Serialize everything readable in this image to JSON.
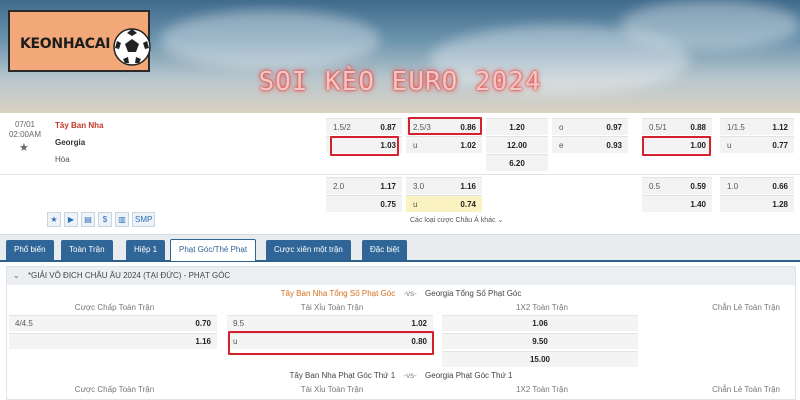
{
  "banner": {
    "logo_text": "KEONHACAI",
    "title": "SOI KÈO EURO 2024"
  },
  "match": {
    "date": "07/01",
    "time": "02:00AM",
    "home": "Tây Ban Nha",
    "away": "Georgia",
    "draw": "Hòa",
    "row1": {
      "hdp1": {
        "line": "1.5/2",
        "home": "0.87",
        "away": "1.03"
      },
      "ou1": {
        "line": "2.5/3",
        "over": "0.86",
        "under_label": "u",
        "under": "1.02"
      },
      "x12": [
        "1.20",
        "12.00",
        "6.20"
      ],
      "oe": {
        "o_label": "o",
        "o": "0.97",
        "e_label": "e",
        "e": "0.93"
      },
      "hdp2": {
        "line": "0.5/1",
        "home": "0.88",
        "away": "1.00"
      },
      "ou2": {
        "line": "1/1.5",
        "over": "1.12",
        "under_label": "u",
        "under": "0.77"
      }
    },
    "row2": {
      "hdp1": {
        "line": "2.0",
        "home": "1.17",
        "away": "0.75"
      },
      "ou1": {
        "line": "3.0",
        "over": "1.16",
        "under_label": "u",
        "under": "0.74"
      },
      "hdp2": {
        "line": "0.5",
        "home": "0.59",
        "away": "1.40"
      },
      "ou2": {
        "line": "1.0",
        "over": "0.66",
        "under": "1.28"
      }
    },
    "icons": [
      "★",
      "▶",
      "▤",
      "$",
      "▥",
      "SMP"
    ],
    "more_label": "Các loại cược Châu Á khác ⌄"
  },
  "tabs": [
    "Phổ biến",
    "Toàn Trận",
    "Hiệp 1",
    "Phạt Góc/Thẻ Phạt",
    "Cược xiên một trận",
    "Đặc biệt"
  ],
  "active_tab": 3,
  "corner": {
    "league": "*GIẢI VÔ ĐỊCH CHÂU ÂU 2024 (TẠI ĐỨC) - PHẠT GÓC",
    "total_home": "Tây Ban Nha Tổng Số Phạt Góc",
    "vs": "-vs-",
    "total_away": "Georgia Tổng Số Phạt Góc",
    "col_hdp": "Cược Chấp Toàn Trận",
    "col_ou": "Tài Xỉu Toàn Trận",
    "col_1x2": "1X2 Toàn Trận",
    "col_oe": "Chẵn Lẻ Toàn Trận",
    "hdp": {
      "line": "4/4.5",
      "home": "0.70",
      "away": "1.16"
    },
    "ou": {
      "line": "9.5",
      "over": "1.02",
      "under_label": "u",
      "under": "0.80"
    },
    "x12": [
      "1.06",
      "9.50",
      "15.00"
    ],
    "first_home": "Tây Ban Nha Phạt Góc Thứ 1",
    "first_away": "Georgia Phạt Góc Thứ 1"
  }
}
